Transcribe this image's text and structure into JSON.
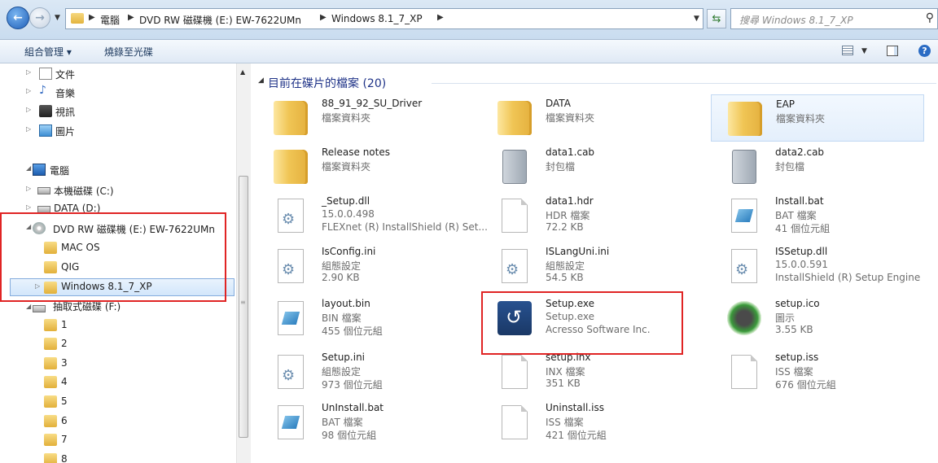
{
  "address": {
    "breadcrumbs": [
      "電腦",
      "DVD RW 磁碟機 (E:) EW-7622UMn",
      "Windows 8.1_7_XP"
    ],
    "search_placeholder": "搜尋 Windows 8.1_7_XP"
  },
  "toolbar": {
    "organize": "組合管理 ▾",
    "burn": "燒錄至光碟"
  },
  "nav": {
    "libraries": [
      "文件",
      "音樂",
      "視訊",
      "圖片"
    ],
    "computer": "電腦",
    "drive_c": "本機磁碟 (C:)",
    "drive_d": "DATA (D:)",
    "drive_e": "DVD RW 磁碟機 (E:) EW-7622UMn",
    "e_children": [
      "MAC OS",
      "QIG",
      "Windows 8.1_7_XP"
    ],
    "drive_f": "抽取式磁碟 (F:)",
    "f_children": [
      "1",
      "2",
      "3",
      "4",
      "5",
      "6",
      "7",
      "8"
    ]
  },
  "content": {
    "group_title": "目前在碟片的檔案 (20)",
    "files": [
      {
        "name": "88_91_92_SU_Driver",
        "line2": "檔案資料夾",
        "line3": "",
        "icon": "folder-icon"
      },
      {
        "name": "DATA",
        "line2": "檔案資料夾",
        "line3": "",
        "icon": "folder-icon"
      },
      {
        "name": "EAP",
        "line2": "檔案資料夾",
        "line3": "",
        "icon": "folder-icon"
      },
      {
        "name": "Release notes",
        "line2": "檔案資料夾",
        "line3": "",
        "icon": "folder-icon"
      },
      {
        "name": "data1.cab",
        "line2": "封包檔",
        "line3": "",
        "icon": "cabinet-icon"
      },
      {
        "name": "data2.cab",
        "line2": "封包檔",
        "line3": "",
        "icon": "cabinet-icon"
      },
      {
        "name": "_Setup.dll",
        "line2": "15.0.0.498",
        "line3": "FLEXnet (R) InstallShield (R) Set...",
        "icon": "gear-file-icon"
      },
      {
        "name": "data1.hdr",
        "line2": "HDR 檔案",
        "line3": "72.2 KB",
        "icon": "file-icon"
      },
      {
        "name": "Install.bat",
        "line2": "BAT 檔案",
        "line3": "41 個位元組",
        "icon": "batch-file-icon"
      },
      {
        "name": "IsConfig.ini",
        "line2": "組態設定",
        "line3": "2.90 KB",
        "icon": "gear-file-icon"
      },
      {
        "name": "ISLangUni.ini",
        "line2": "組態設定",
        "line3": "54.5 KB",
        "icon": "gear-file-icon"
      },
      {
        "name": "ISSetup.dll",
        "line2": "15.0.0.591",
        "line3": "InstallShield (R) Setup Engine",
        "icon": "gear-file-icon"
      },
      {
        "name": "layout.bin",
        "line2": "BIN 檔案",
        "line3": "455 個位元組",
        "icon": "batch-file-icon"
      },
      {
        "name": "Setup.exe",
        "line2": "Setup.exe",
        "line3": "Acresso Software Inc.",
        "icon": "setup-exe-icon"
      },
      {
        "name": "setup.ico",
        "line2": "圖示",
        "line3": "3.55 KB",
        "icon": "setup-ico-icon"
      },
      {
        "name": "Setup.ini",
        "line2": "組態設定",
        "line3": "973 個位元組",
        "icon": "gear-file-icon"
      },
      {
        "name": "setup.inx",
        "line2": "INX 檔案",
        "line3": "351 KB",
        "icon": "file-icon"
      },
      {
        "name": "setup.iss",
        "line2": "ISS 檔案",
        "line3": "676 個位元組",
        "icon": "file-icon"
      },
      {
        "name": "UnInstall.bat",
        "line2": "BAT 檔案",
        "line3": "98 個位元組",
        "icon": "batch-file-icon"
      },
      {
        "name": "Uninstall.iss",
        "line2": "ISS 檔案",
        "line3": "421 個位元組",
        "icon": "file-icon"
      }
    ]
  },
  "colors": {
    "highlight_box": "#e02424",
    "group_title": "#1e3287",
    "selection": "#d2e6fb"
  }
}
